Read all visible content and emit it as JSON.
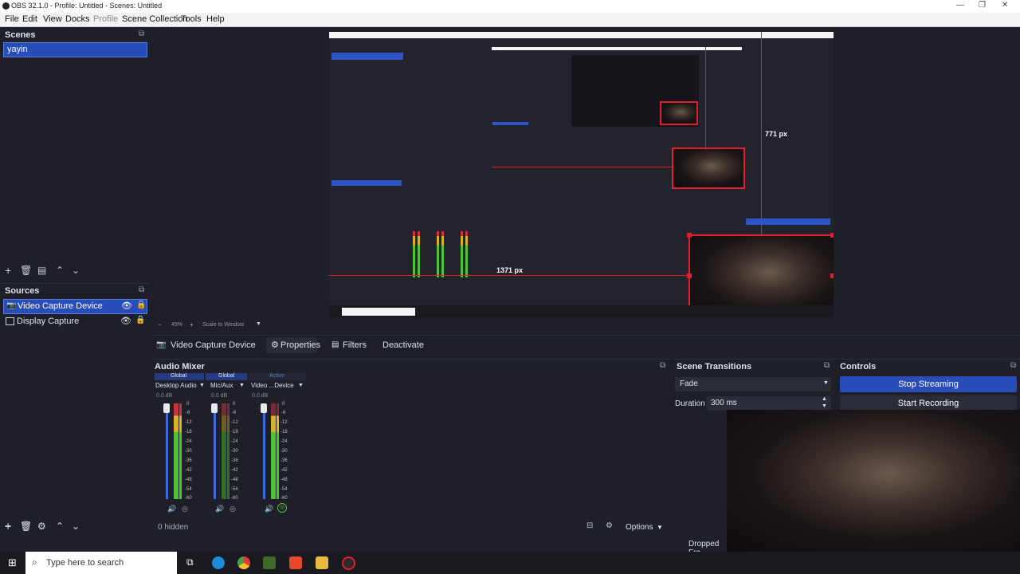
{
  "window": {
    "title": "OBS 32.1.0 - Profile: Untitled - Scenes: Untitled",
    "controls": [
      "—",
      "❐",
      "✕"
    ]
  },
  "menu": {
    "items": [
      "File",
      "Edit",
      "View",
      "Docks",
      "Profile",
      "Scene Collection",
      "Tools",
      "Help"
    ]
  },
  "scenes": {
    "title": "Scenes",
    "items": [
      "yayin"
    ]
  },
  "sources": {
    "title": "Sources",
    "items": [
      "Video Capture Device",
      "Display Capture"
    ]
  },
  "preview": {
    "label_width": "1371 px",
    "label_height": "771 px"
  },
  "zoom_bar": {
    "zoom": "49%",
    "mode": "Scale to Window"
  },
  "source_toolbar": {
    "source_name": "Video Capture Device",
    "properties": "Properties",
    "filters": "Filters",
    "deactivate": "Deactivate"
  },
  "audio_mixer": {
    "title": "Audio Mixer",
    "channels": [
      {
        "badge": "Global",
        "name": "Desktop Audio",
        "db": "0.0 dB"
      },
      {
        "badge": "Global",
        "name": "Mic/Aux",
        "db": "0.0 dB"
      },
      {
        "badge": "Active",
        "name": "Video ...Device",
        "db": "0.0 dB"
      }
    ],
    "ticks": [
      "0",
      "-6",
      "-12",
      "-18",
      "-24",
      "-30",
      "-36",
      "-42",
      "-48",
      "-54",
      "-60"
    ],
    "hidden": "0 hidden",
    "options": "Options"
  },
  "transitions": {
    "title": "Scene Transitions",
    "selected": "Fade",
    "duration_label": "Duration",
    "duration_value": "300 ms"
  },
  "controls": {
    "title": "Controls",
    "stop_streaming": "Stop Streaming",
    "start_recording": "Start Recording"
  },
  "status": {
    "dropped": "Dropped Fra"
  },
  "taskbar": {
    "search_placeholder": "Type here to search"
  },
  "colors": {
    "accent": "#284cb8",
    "panel_bg": "#1e1f29",
    "red_guides": "#e0202a",
    "meter_green": "#4ec23a",
    "meter_yellow": "#d6b32a",
    "meter_red": "#d0303c"
  }
}
